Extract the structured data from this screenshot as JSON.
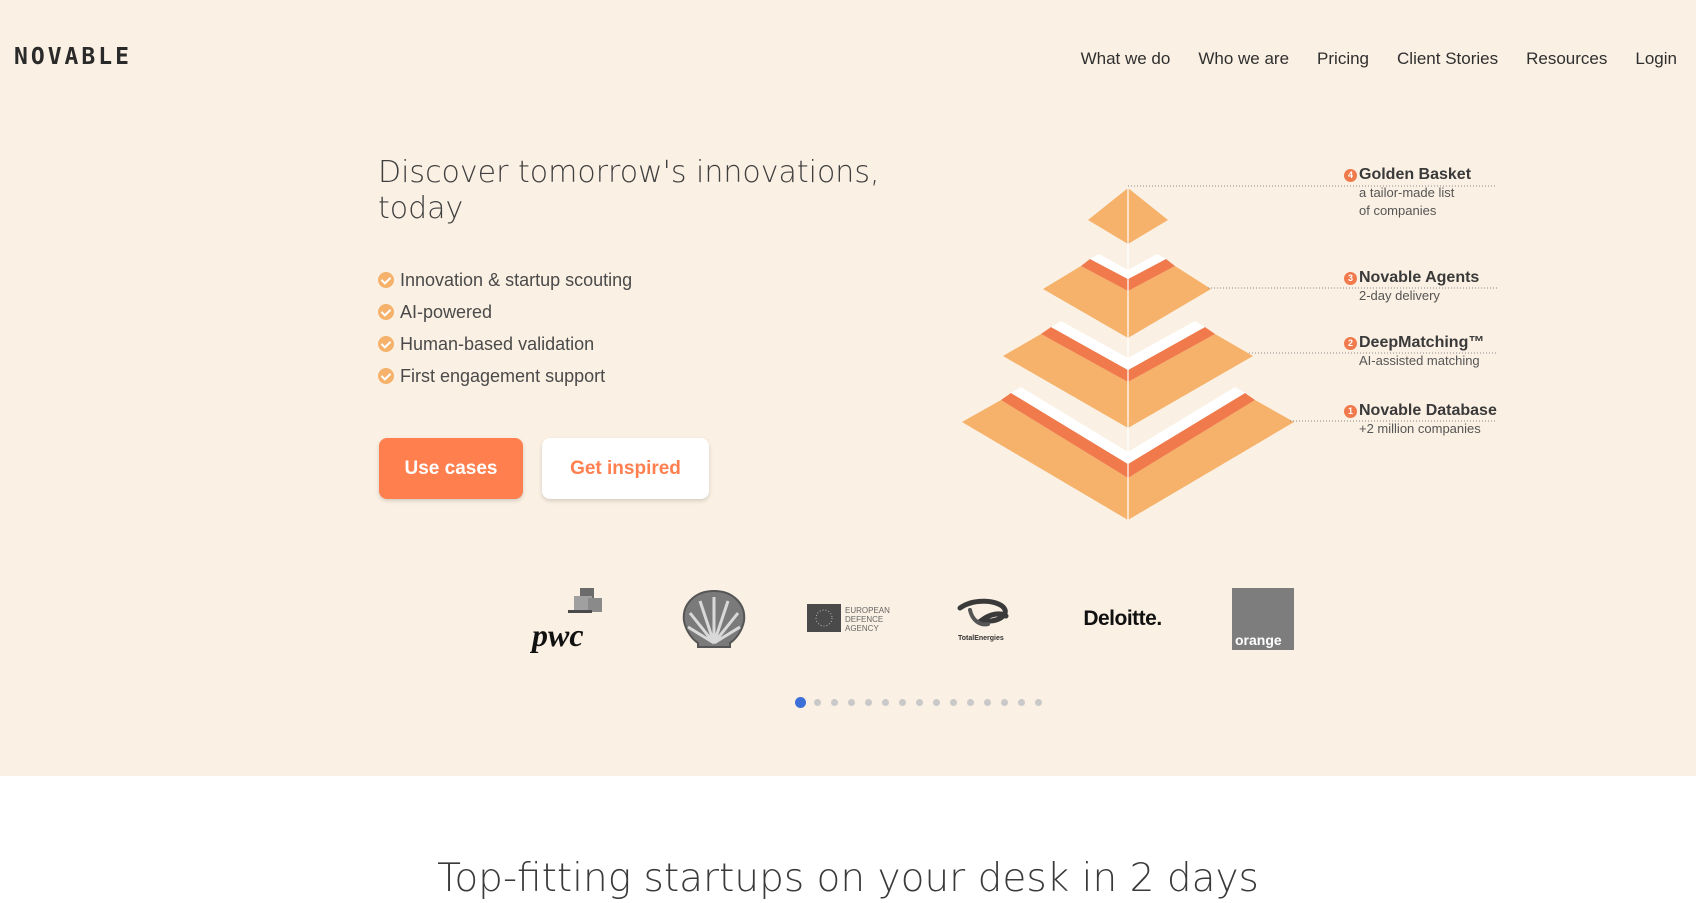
{
  "header": {
    "logo": "NOVABLE",
    "nav": [
      "What we do",
      "Who we are",
      "Pricing",
      "Client Stories",
      "Resources",
      "Login"
    ]
  },
  "hero": {
    "headline_line1": "Discover tomorrow's innovations,",
    "headline_line2": "today",
    "features": [
      "Innovation & startup scouting",
      "AI-powered",
      "Human-based validation",
      "First engagement support"
    ],
    "primary_button": "Use cases",
    "secondary_button": "Get inspired"
  },
  "pyramid": {
    "levels": [
      {
        "num": "4",
        "title": "Golden Basket",
        "sub1": "a tailor-made list",
        "sub2": "of companies"
      },
      {
        "num": "3",
        "title": "Novable Agents",
        "sub1": "2-day delivery",
        "sub2": ""
      },
      {
        "num": "2",
        "title": "DeepMatching™",
        "sub1": "AI-assisted matching",
        "sub2": ""
      },
      {
        "num": "1",
        "title": "Novable Database",
        "sub1": "+2 million companies",
        "sub2": ""
      }
    ]
  },
  "clients": {
    "logos": [
      "pwc-logo",
      "shell-logo",
      "european-defence-agency-logo",
      "totalenergies-logo",
      "deloitte-logo",
      "orange-logo"
    ],
    "pwc": "pwc",
    "eda_line1": "EUROPEAN",
    "eda_line2": "DEFENCE",
    "eda_line3": "AGENCY",
    "total": "TotalEnergies",
    "deloitte": "Deloitte.",
    "orange": "orange"
  },
  "carousel": {
    "active_index": 0,
    "count": 15
  },
  "section": {
    "title": "Top-fitting startups on your desk in 2 days"
  },
  "colors": {
    "accent": "#ff7f4f",
    "hero_bg": "#faf0e3",
    "pyramid": "#f6b26b",
    "active_dot": "#3d6fd9"
  }
}
